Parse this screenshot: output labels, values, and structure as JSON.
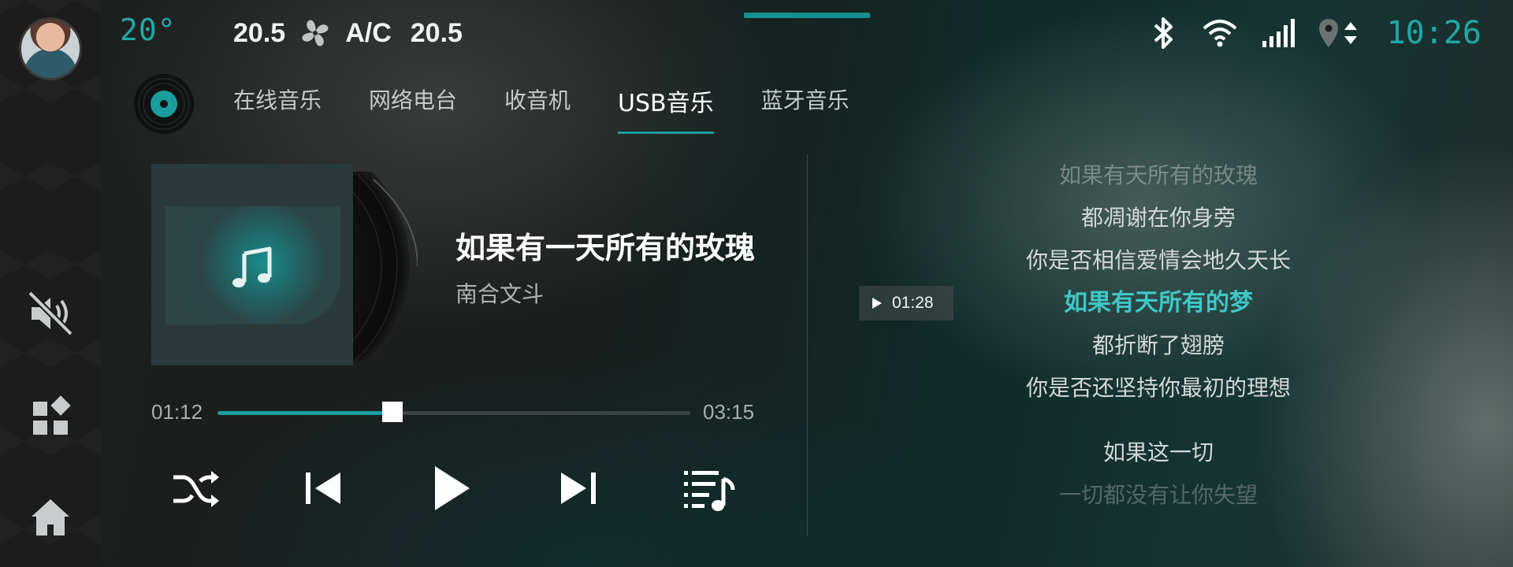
{
  "status": {
    "temperature": "20°",
    "climate_left": "20.5",
    "climate_mode": "A/C",
    "climate_right": "20.5",
    "time": "10:26"
  },
  "tabs": [
    {
      "label": "在线音乐"
    },
    {
      "label": "网络电台"
    },
    {
      "label": "收音机"
    },
    {
      "label": "USB音乐",
      "active": true
    },
    {
      "label": "蓝牙音乐"
    }
  ],
  "now_playing": {
    "title": "如果有一天所有的玫瑰",
    "artist": "南合文斗",
    "elapsed": "01:12",
    "duration": "03:15",
    "progress": 0.37
  },
  "lyrics": {
    "seek_time": "01:28",
    "lines": [
      "如果有天所有的玫瑰",
      "都凋谢在你身旁",
      "你是否相信爱情会地久天长",
      "如果有天所有的梦",
      "都折断了翅膀",
      "你是否还坚持你最初的理想",
      "如果这一切",
      "一切都没有让你失望"
    ],
    "current_index": 3
  },
  "colors": {
    "accent": "#1a9d9d",
    "lyric_current": "#3ec7c7"
  },
  "icons": {
    "sidebar": [
      "mute-icon",
      "apps-icon",
      "home-icon"
    ],
    "status": [
      "fan-icon",
      "bluetooth-icon",
      "wifi-icon",
      "signal-icon",
      "location-icon"
    ],
    "controls": [
      "shuffle-icon",
      "previous-icon",
      "play-icon",
      "next-icon",
      "playlist-icon"
    ]
  }
}
